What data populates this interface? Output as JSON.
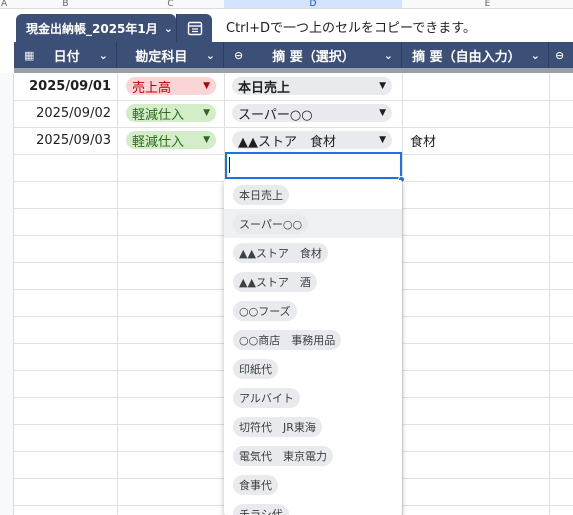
{
  "columns": {
    "corner": "A",
    "letters": [
      "B",
      "C",
      "D",
      "E"
    ]
  },
  "table_tab": {
    "name": "現金出納帳_2025年1月",
    "hint": "Ctrl+Dで一つ上のセルをコピーできます。"
  },
  "headers": {
    "date": "日付",
    "account": "勘定科目",
    "summary_select": "摘 要（選択）",
    "summary_free": "摘 要（自由入力）"
  },
  "rows": [
    {
      "date": "2025/09/01",
      "account": "売上高",
      "account_color": "red",
      "summary": "本日売上",
      "free": ""
    },
    {
      "date": "2025/09/02",
      "account": "軽減仕入",
      "account_color": "green",
      "summary": "スーパー○○",
      "free": ""
    },
    {
      "date": "2025/09/03",
      "account": "軽減仕入",
      "account_color": "green",
      "summary": "▲▲ストア　食材",
      "free": "食材"
    }
  ],
  "dropdown": {
    "options": [
      "本日売上",
      "スーパー○○",
      "▲▲ストア　食材",
      "▲▲ストア　酒",
      "○○フーズ",
      "○○商店　事務用品",
      "印紙代",
      "アルバイト",
      "切符代　JR東海",
      "電気代　東京電力",
      "食事代",
      "チラシ代"
    ],
    "highlighted": "スーパー○○"
  },
  "colors": {
    "header_bg": "#3c4f76",
    "selection": "#1a73e8",
    "chip_red_bg": "#fbd5d5",
    "chip_green_bg": "#d4edc9"
  }
}
